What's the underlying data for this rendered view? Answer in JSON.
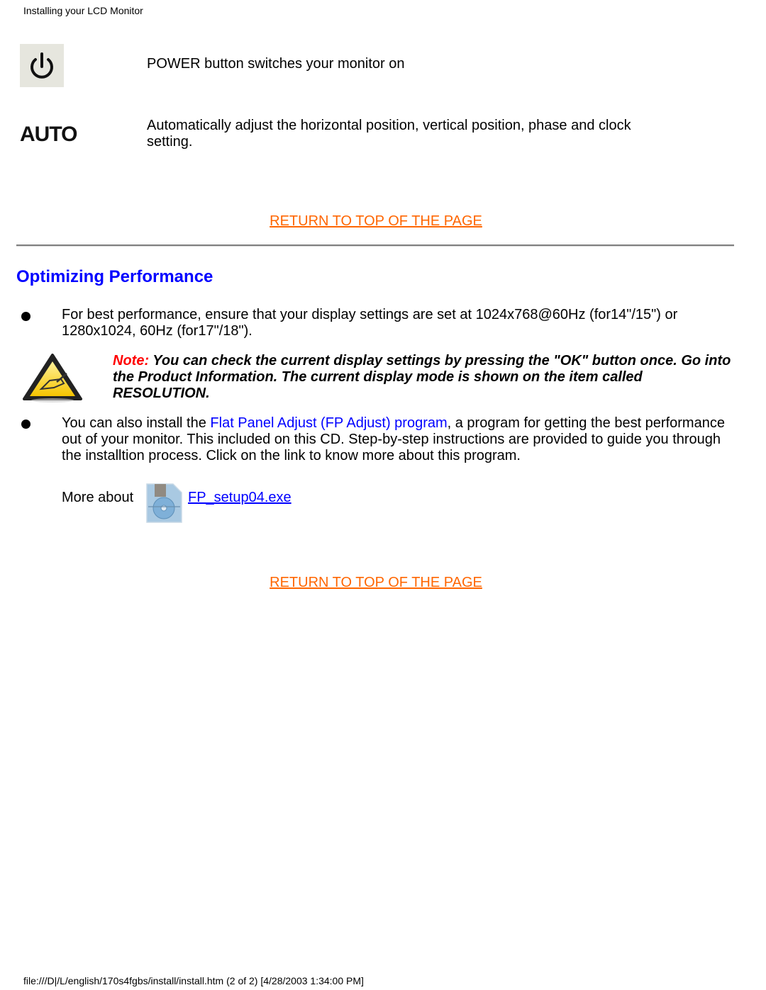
{
  "header": {
    "title": "Installing your LCD Monitor"
  },
  "controls": [
    {
      "icon": "power-icon",
      "description": "POWER button switches your monitor on"
    },
    {
      "icon": "auto-icon",
      "icon_label": "AUTO",
      "description": "Automatically adjust the horizontal position, vertical position, phase and clock setting."
    }
  ],
  "return_link": {
    "label": "RETURN TO TOP OF THE PAGE"
  },
  "section": {
    "title": "Optimizing Performance",
    "bullet1": "For best performance, ensure that your display settings are set at 1024x768@60Hz (for14\"/15\") or 1280x1024, 60Hz (for17\"/18\").",
    "note": {
      "label": "Note:",
      "text": " You can check the current display settings by pressing the \"OK\" button once. Go into the Product Information. The current display mode is shown on the item called RESOLUTION."
    },
    "bullet2": {
      "before": "You can also install the ",
      "link": "Flat Panel Adjust (FP Adjust) program",
      "after": ", a program for getting the best performance out of your monitor. This included on this CD. Step-by-step instructions are provided to guide you through the installtion process. Click on the link to know more about this program."
    },
    "more_about": {
      "label": "More about",
      "file_link": "FP_setup04.exe"
    }
  },
  "footer": {
    "text": "file:///D|/L/english/170s4fgbs/install/install.htm (2 of 2) [4/28/2003 1:34:00 PM]"
  },
  "colors": {
    "link_orange": "#ff6600",
    "heading_blue": "#0000ff",
    "note_red": "#ff0000",
    "warning_yellow": "#ffcc00"
  }
}
